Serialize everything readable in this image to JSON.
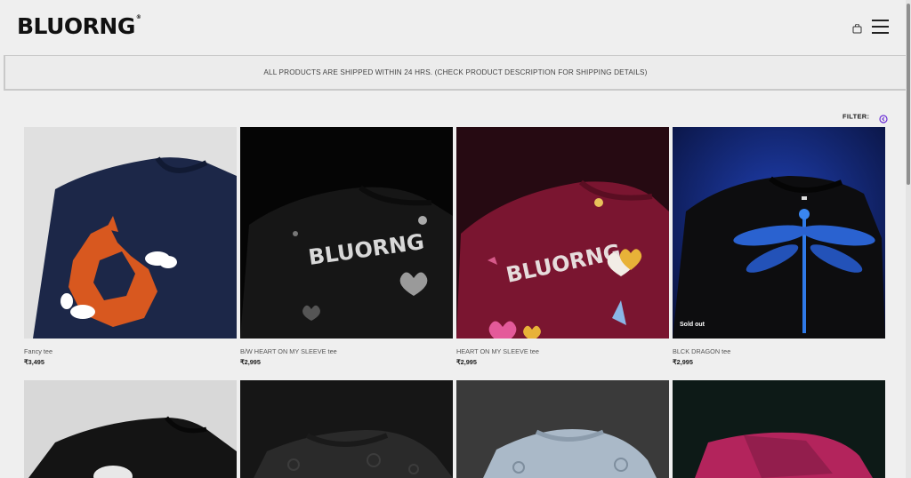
{
  "header": {
    "logo": "BLUORNG",
    "logo_mark": "®",
    "cart_icon": "shopping-bag-icon",
    "menu_icon": "hamburger-menu-icon"
  },
  "banner": {
    "text": "ALL PRODUCTS ARE SHIPPED WITHIN 24 HRS. (CHECK PRODUCT DESCRIPTION FOR SHIPPING DETAILS)"
  },
  "filter": {
    "label": "FILTER:",
    "icon": "filter-circle-icon",
    "accent_color": "#6b2fd6"
  },
  "products": [
    {
      "name": "Fancy tee",
      "price": "₹3,495",
      "badge": ""
    },
    {
      "name": "B/W HEART ON MY SLEEVE tee",
      "price": "₹2,995",
      "badge": ""
    },
    {
      "name": "HEART ON MY SLEEVE tee",
      "price": "₹2,995",
      "badge": ""
    },
    {
      "name": "BLCK DRAGON tee",
      "price": "₹2,995",
      "badge": "Sold out"
    }
  ],
  "tee_print": "BLUORNG"
}
